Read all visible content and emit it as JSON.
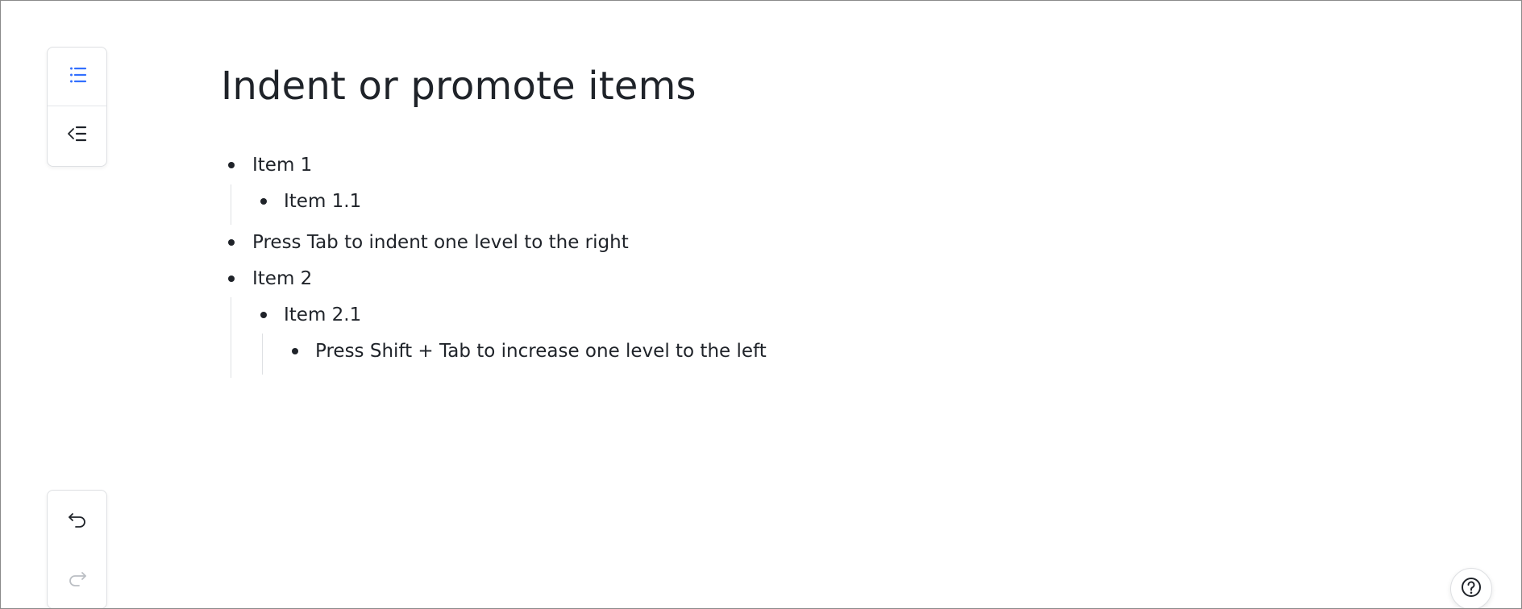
{
  "toolbar_top": {
    "indent_icon": "indent-right-icon",
    "outdent_icon": "outdent-left-icon"
  },
  "toolbar_bottom": {
    "undo_icon": "undo-icon",
    "redo_icon": "redo-icon"
  },
  "page": {
    "title": "Indent or promote items"
  },
  "list": {
    "items": [
      {
        "text": "Item 1",
        "level": 1
      },
      {
        "text": "Item 1.1",
        "level": 2
      },
      {
        "text": "Press Tab to indent one level to the right",
        "level": 1
      },
      {
        "text": "Item 2",
        "level": 1
      },
      {
        "text": "Item 2.1",
        "level": 2
      },
      {
        "text": "Press Shift + Tab to increase one level to the left",
        "level": 3
      }
    ]
  },
  "help": {
    "icon": "help-icon"
  },
  "colors": {
    "accent": "#3370ff",
    "text": "#1f2329",
    "disabled": "#bbbfc4",
    "border": "#dee0e3"
  }
}
